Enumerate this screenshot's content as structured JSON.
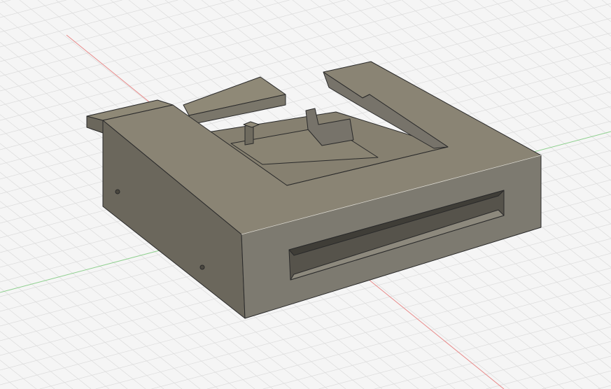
{
  "viewport": {
    "background": "#f5f5f5",
    "grid_color": "#dcdcdc",
    "x_axis_color": "#e88a8a",
    "y_axis_color": "#8fd08f"
  },
  "model": {
    "top_color": "#8a8474",
    "front_color": "#7d7a70",
    "side_color": "#6b675c",
    "edge_color": "#2a2a2a"
  }
}
